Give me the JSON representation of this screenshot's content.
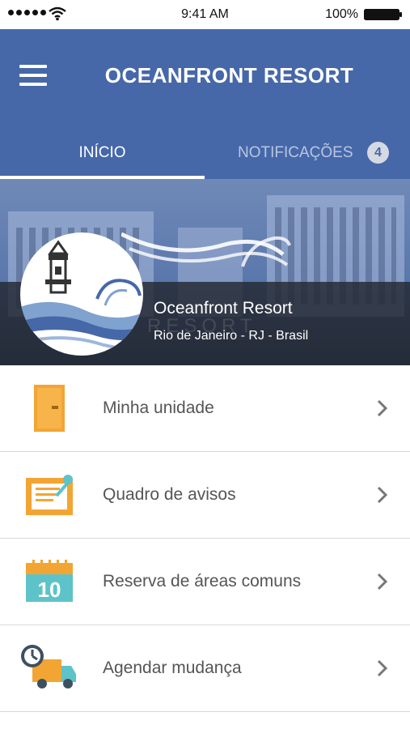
{
  "status_bar": {
    "time": "9:41 AM",
    "battery": "100%",
    "icons": [
      "signal-dots-icon",
      "wifi-icon",
      "battery-icon"
    ]
  },
  "header": {
    "title": "OCEANFRONT RESORT",
    "menu_icon": "hamburger-menu-icon"
  },
  "tabs": [
    {
      "label": "INÍCIO",
      "active": true
    },
    {
      "label": "NOTIFICAÇÕES",
      "badge": "4",
      "active": false
    }
  ],
  "hero": {
    "name": "Oceanfront Resort",
    "location": "Rio de Janeiro - RJ - Brasil",
    "watermark": "RESORT",
    "logo_icon": "lighthouse-waves-logo"
  },
  "menu": [
    {
      "label": "Minha unidade",
      "icon": "door-icon"
    },
    {
      "label": "Quadro de avisos",
      "icon": "notice-board-icon"
    },
    {
      "label": "Reserva de áreas comuns",
      "icon": "calendar-icon",
      "icon_text": "10"
    },
    {
      "label": "Agendar mudança",
      "icon": "moving-truck-icon"
    }
  ],
  "colors": {
    "header_bg": "#4668a9",
    "accent_orange": "#f3a533",
    "accent_teal": "#5ec3c9"
  }
}
